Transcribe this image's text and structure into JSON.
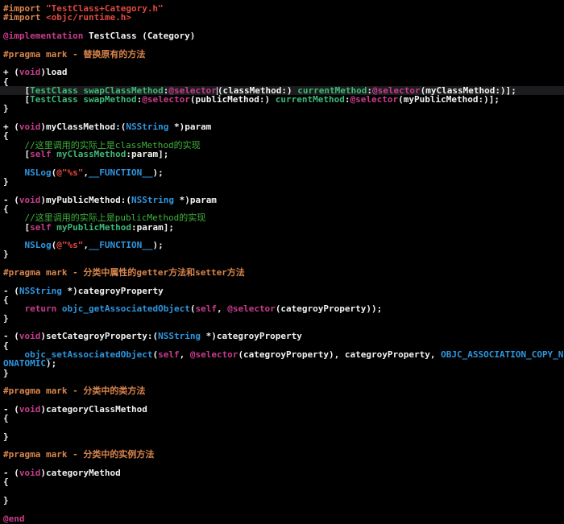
{
  "colors": {
    "background": "#000000",
    "plain": "#f2f2f2",
    "keyword": "#c83c8c",
    "preprocessor": "#d9844c",
    "string": "#e0493f",
    "project": "#3dba77",
    "comment": "#3fb43c",
    "type": "#2e97e0"
  },
  "current_line": 9,
  "cursor_line": 9,
  "cursor_after_token": 5,
  "lines": [
    [
      [
        "#import ",
        "pp"
      ],
      [
        "\"TestClass+Category.h\"",
        "s"
      ]
    ],
    [
      [
        "#import ",
        "pp"
      ],
      [
        "<objc/runtime.h>",
        "s"
      ]
    ],
    [],
    [
      [
        "@implementation",
        "k"
      ],
      [
        " TestClass (Category)",
        "p"
      ]
    ],
    [],
    [
      [
        "#pragma mark - 替换原有的方法",
        "pp"
      ]
    ],
    [],
    [
      [
        "+ (",
        "p"
      ],
      [
        "void",
        "k"
      ],
      [
        ")load",
        "p"
      ]
    ],
    [
      [
        "{",
        "p"
      ]
    ],
    [
      [
        "    [",
        "p"
      ],
      [
        "TestClass",
        "g"
      ],
      [
        " ",
        "p"
      ],
      [
        "swapClassMethod",
        "g"
      ],
      [
        ":",
        "p"
      ],
      [
        "@selector",
        "k"
      ],
      [
        "(classMethod:) ",
        "p"
      ],
      [
        "currentMethod",
        "g"
      ],
      [
        ":",
        "p"
      ],
      [
        "@selector",
        "k"
      ],
      [
        "(myClassMethod:)];",
        "p"
      ]
    ],
    [
      [
        "    [",
        "p"
      ],
      [
        "TestClass",
        "g"
      ],
      [
        " ",
        "p"
      ],
      [
        "swapMethod",
        "g"
      ],
      [
        ":",
        "p"
      ],
      [
        "@selector",
        "k"
      ],
      [
        "(publicMethod:) ",
        "p"
      ],
      [
        "currentMethod",
        "g"
      ],
      [
        ":",
        "p"
      ],
      [
        "@selector",
        "k"
      ],
      [
        "(myPublicMethod:)];",
        "p"
      ]
    ],
    [
      [
        "}",
        "p"
      ]
    ],
    [],
    [
      [
        "+ (",
        "p"
      ],
      [
        "void",
        "k"
      ],
      [
        ")myClassMethod:(",
        "p"
      ],
      [
        "NSString",
        "b"
      ],
      [
        " *)param",
        "p"
      ]
    ],
    [
      [
        "{",
        "p"
      ]
    ],
    [
      [
        "    ",
        "p"
      ],
      [
        "//这里调用的实际上是classMethod的实现",
        "c"
      ]
    ],
    [
      [
        "    [",
        "p"
      ],
      [
        "self",
        "k"
      ],
      [
        " ",
        "p"
      ],
      [
        "myClassMethod",
        "g"
      ],
      [
        ":param];",
        "p"
      ]
    ],
    [],
    [
      [
        "    ",
        "p"
      ],
      [
        "NSLog",
        "b"
      ],
      [
        "(",
        "p"
      ],
      [
        "@\"%s\"",
        "s"
      ],
      [
        ",",
        "p"
      ],
      [
        "__FUNCTION__",
        "b"
      ],
      [
        ");",
        "p"
      ]
    ],
    [
      [
        "}",
        "p"
      ]
    ],
    [],
    [
      [
        "- (",
        "p"
      ],
      [
        "void",
        "k"
      ],
      [
        ")myPublicMethod:(",
        "p"
      ],
      [
        "NSString",
        "b"
      ],
      [
        " *)param",
        "p"
      ]
    ],
    [
      [
        "{",
        "p"
      ]
    ],
    [
      [
        "    ",
        "p"
      ],
      [
        "//这里调用的实际上是publicMethod的实现",
        "c"
      ]
    ],
    [
      [
        "    [",
        "p"
      ],
      [
        "self",
        "k"
      ],
      [
        " ",
        "p"
      ],
      [
        "myPublicMethod",
        "g"
      ],
      [
        ":param];",
        "p"
      ]
    ],
    [],
    [
      [
        "    ",
        "p"
      ],
      [
        "NSLog",
        "b"
      ],
      [
        "(",
        "p"
      ],
      [
        "@\"%s\"",
        "s"
      ],
      [
        ",",
        "p"
      ],
      [
        "__FUNCTION__",
        "b"
      ],
      [
        ");",
        "p"
      ]
    ],
    [
      [
        "}",
        "p"
      ]
    ],
    [],
    [
      [
        "#pragma mark - 分类中属性的getter方法和setter方法",
        "pp"
      ]
    ],
    [],
    [
      [
        "- (",
        "p"
      ],
      [
        "NSString",
        "b"
      ],
      [
        " *)categroyProperty",
        "p"
      ]
    ],
    [
      [
        "{",
        "p"
      ]
    ],
    [
      [
        "    ",
        "p"
      ],
      [
        "return",
        "k"
      ],
      [
        " ",
        "p"
      ],
      [
        "objc_getAssociatedObject",
        "b"
      ],
      [
        "(",
        "p"
      ],
      [
        "self",
        "k"
      ],
      [
        ", ",
        "p"
      ],
      [
        "@selector",
        "k"
      ],
      [
        "(categroyProperty));",
        "p"
      ]
    ],
    [
      [
        "}",
        "p"
      ]
    ],
    [],
    [
      [
        "- (",
        "p"
      ],
      [
        "void",
        "k"
      ],
      [
        ")setCategroyProperty:(",
        "p"
      ],
      [
        "NSString",
        "b"
      ],
      [
        " *)categroyProperty",
        "p"
      ]
    ],
    [
      [
        "{",
        "p"
      ]
    ],
    [
      [
        "    ",
        "p"
      ],
      [
        "objc_setAssociatedObject",
        "b"
      ],
      [
        "(",
        "p"
      ],
      [
        "self",
        "k"
      ],
      [
        ", ",
        "p"
      ],
      [
        "@selector",
        "k"
      ],
      [
        "(categroyProperty), categroyProperty, ",
        "p"
      ],
      [
        "OBJC_ASSOCIATION_COPY_NONATOMIC",
        "b"
      ],
      [
        ");",
        "p"
      ]
    ],
    [
      [
        "}",
        "p"
      ]
    ],
    [],
    [
      [
        "#pragma mark - 分类中的类方法",
        "pp"
      ]
    ],
    [],
    [
      [
        "- (",
        "p"
      ],
      [
        "void",
        "k"
      ],
      [
        ")categoryClassMethod",
        "p"
      ]
    ],
    [
      [
        "{",
        "p"
      ]
    ],
    [],
    [
      [
        "}",
        "p"
      ]
    ],
    [],
    [
      [
        "#pragma mark - 分类中的实例方法",
        "pp"
      ]
    ],
    [],
    [
      [
        "- (",
        "p"
      ],
      [
        "void",
        "k"
      ],
      [
        ")categoryMethod",
        "p"
      ]
    ],
    [
      [
        "{",
        "p"
      ]
    ],
    [],
    [
      [
        "}",
        "p"
      ]
    ],
    [],
    [
      [
        "@end",
        "k"
      ]
    ]
  ]
}
